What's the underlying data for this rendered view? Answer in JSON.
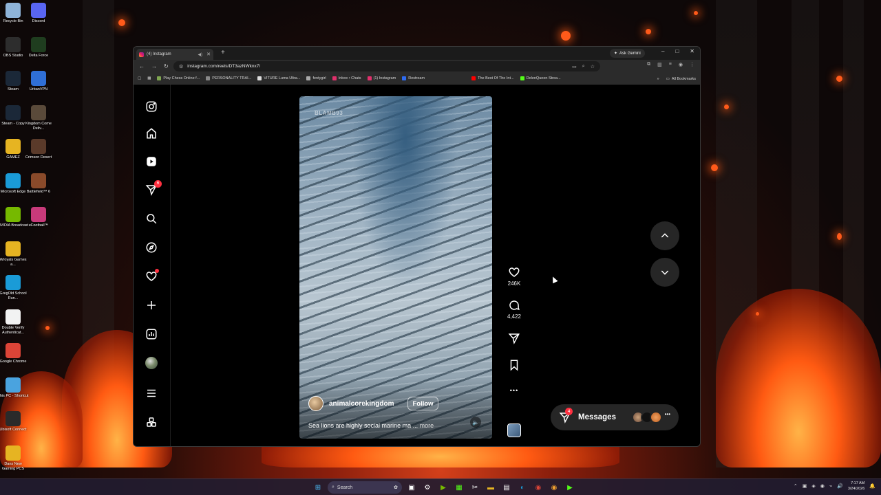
{
  "desktop": {
    "left_icons": [
      {
        "label": "Recycle Bin",
        "icon": "recycle-bin-icon",
        "color": "#8fb4d9"
      },
      {
        "label": "OBS Studio",
        "icon": "obs-icon",
        "color": "#2d2d2d"
      },
      {
        "label": "Steam",
        "icon": "steam-icon",
        "color": "#1b2838"
      },
      {
        "label": "Steam - Copy",
        "icon": "steam-icon",
        "color": "#1b2838"
      },
      {
        "label": "GAMEZ",
        "icon": "folder-icon",
        "color": "#e6b422"
      },
      {
        "label": "Microsoft Edge",
        "icon": "edge-icon",
        "color": "#1a9bd7"
      },
      {
        "label": "NVIDIA Broadcast",
        "icon": "nvidia-icon",
        "color": "#76b900"
      },
      {
        "label": "Wroyals Games a...",
        "icon": "folder-icon",
        "color": "#e6b422"
      },
      {
        "label": "GregOld School Run...",
        "icon": "edge-icon",
        "color": "#1a9bd7"
      },
      {
        "label": "Double Verify Authenticat...",
        "icon": "document-icon",
        "color": "#f2f2f2"
      },
      {
        "label": "Google Chrome",
        "icon": "chrome-icon",
        "color": "#db4437"
      },
      {
        "label": "This PC - Shortcut",
        "icon": "computer-icon",
        "color": "#4aa3df"
      },
      {
        "label": "Ubisoft Connect",
        "icon": "ubisoft-icon",
        "color": "#2a2a2a"
      },
      {
        "label": "Dans New Gaming PCS",
        "icon": "folder-icon",
        "color": "#e6b422"
      }
    ],
    "right_icons": [
      {
        "label": "Discord",
        "icon": "discord-icon",
        "color": "#5865f2"
      },
      {
        "label": "Delta Force",
        "icon": "delta-force-icon",
        "color": "#1f3d1f"
      },
      {
        "label": "UrbanVPN",
        "icon": "vpn-icon",
        "color": "#2f6fd6"
      },
      {
        "label": "Kingdom Come Deliv...",
        "icon": "game-icon",
        "color": "#5a4a3a"
      },
      {
        "label": "Crimson Desert",
        "icon": "game-icon",
        "color": "#5a3a2a"
      },
      {
        "label": "Battlefield™ 6",
        "icon": "game-icon",
        "color": "#8a4a2a"
      },
      {
        "label": "eFootball™",
        "icon": "game-icon",
        "color": "#c83a7a"
      }
    ]
  },
  "browser": {
    "tab_title": "(4) Instagram",
    "new_tab_symbol": "+",
    "ask_gemini": "Ask Gemini",
    "window_controls": [
      "–",
      "□",
      "✕"
    ],
    "url": "instagram.com/reels/DT3azNWknx7/",
    "bookmarks": [
      {
        "label": "Play Chess Online f...",
        "color": "#7fa650"
      },
      {
        "label": "PERSONALITY TRAI...",
        "color": "#888888"
      },
      {
        "label": "VITURE Luma Ultra...",
        "color": "#dddddd"
      },
      {
        "label": "fentygirl",
        "color": "#aaaaaa"
      },
      {
        "label": "Inbox • Chats",
        "color": "#e1306c"
      },
      {
        "label": "(1) Instagram",
        "color": "#e1306c"
      },
      {
        "label": "Restream",
        "color": "#2e6bf0"
      },
      {
        "label": "The Best Of The Int...",
        "color": "#ff0000"
      },
      {
        "label": "DelenQueen Strea...",
        "color": "#53fc18"
      }
    ],
    "all_bookmarks": "All Bookmarks"
  },
  "instagram": {
    "nav": [
      {
        "name": "instagram-logo-icon",
        "badge": ""
      },
      {
        "name": "home-icon",
        "badge": ""
      },
      {
        "name": "reels-icon",
        "badge": ""
      },
      {
        "name": "direct-messages-icon",
        "badge": "6"
      },
      {
        "name": "search-icon",
        "badge": ""
      },
      {
        "name": "explore-icon",
        "badge": ""
      },
      {
        "name": "notifications-heart-icon",
        "badge": ""
      },
      {
        "name": "create-plus-icon",
        "badge": ""
      },
      {
        "name": "dashboard-icon",
        "badge": ""
      },
      {
        "name": "profile-avatar",
        "badge": ""
      },
      {
        "name": "menu-icon",
        "badge": ""
      },
      {
        "name": "more-apps-icon",
        "badge": ""
      }
    ],
    "reel": {
      "watermark": "BLAMB93",
      "username": "animalcorekingdom",
      "follow_label": "Follow",
      "caption": "Sea lions are highly social marine ma ...",
      "more_label": "more",
      "likes": "246K",
      "comments": "4,422",
      "options": "•••"
    },
    "messages": {
      "label": "Messages",
      "badge": "4",
      "more": "•••"
    }
  },
  "taskbar": {
    "search_placeholder": "Search",
    "time": "7:17 AM",
    "date": "3/24/2026"
  },
  "colors": {
    "ig_background": "#000000",
    "notification_red": "#ff3040",
    "browser_chrome": "#2b2b2b"
  }
}
